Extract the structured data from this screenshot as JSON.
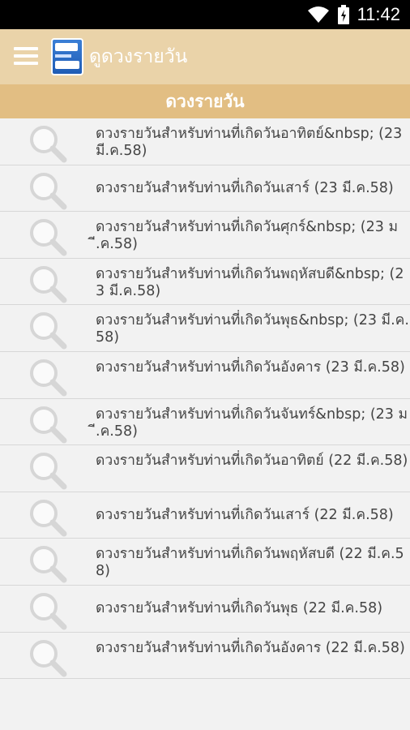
{
  "status_bar": {
    "time": "11:42",
    "wifi_icon": "wifi-icon",
    "battery_icon": "battery-charging-icon"
  },
  "app_bar": {
    "title": "ดูดวงรายวัน",
    "menu_icon": "hamburger-menu-icon",
    "logo_icon": "app-logo-icon"
  },
  "section": {
    "title": "ดวงรายวัน"
  },
  "items": [
    {
      "text": "ดวงรายวันสำหรับท่านที่เกิดวันอาทิตย์&nbsp; (23 มี.ค.58)",
      "single": false
    },
    {
      "text": "ดวงรายวันสำหรับท่านที่เกิดวันเสาร์ (23 มี.ค.58)",
      "single": true
    },
    {
      "text": "ดวงรายวันสำหรับท่านที่เกิดวันศุกร์&nbsp; (23 มี.ค.58)",
      "single": false
    },
    {
      "text": "ดวงรายวันสำหรับท่านที่เกิดวันพฤหัสบดี&nbsp; (23 มี.ค.58)",
      "single": false
    },
    {
      "text": "ดวงรายวันสำหรับท่านที่เกิดวันพุธ&nbsp; (23 มี.ค.58)",
      "single": false
    },
    {
      "text": "ดวงรายวันสำหรับท่านที่เกิดวันอังคาร (23 มี.ค.58)",
      "single": false
    },
    {
      "text": "ดวงรายวันสำหรับท่านที่เกิดวันจันทร์&nbsp; (23 มี.ค.58)",
      "single": false
    },
    {
      "text": "ดวงรายวันสำหรับท่านที่เกิดวันอาทิตย์ (22 มี.ค.58)",
      "single": false
    },
    {
      "text": "ดวงรายวันสำหรับท่านที่เกิดวันเสาร์ (22 มี.ค.58)",
      "single": true
    },
    {
      "text": "ดวงรายวันสำหรับท่านที่เกิดวันพฤหัสบดี (22 มี.ค.58)",
      "single": false
    },
    {
      "text": "ดวงรายวันสำหรับท่านที่เกิดวันพุธ (22 มี.ค.58)",
      "single": true
    },
    {
      "text": "ดวงรายวันสำหรับท่านที่เกิดวันอังคาร (22 มี.ค.58)",
      "single": false
    }
  ],
  "colors": {
    "app_bar": "#ead3a9",
    "section_header": "#e2be83",
    "background": "#f2f2f2",
    "text": "#444444"
  }
}
